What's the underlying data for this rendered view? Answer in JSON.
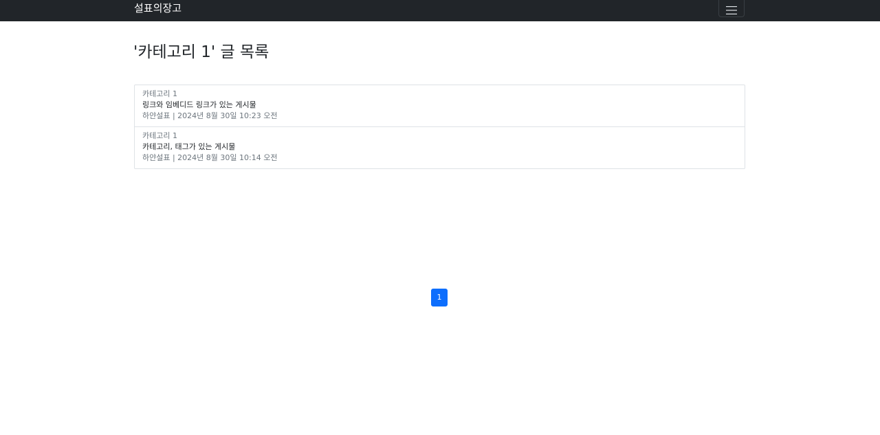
{
  "navbar": {
    "brand": "설표의장고",
    "toggler_icon": "hamburger-menu-icon"
  },
  "page": {
    "title": "'카테고리 1' 글 목록"
  },
  "posts": [
    {
      "category": "카테고리 1",
      "title": "링크와 임베디드 링크가 있는 게시물",
      "meta": "하얀설표 | 2024년 8월 30일 10:23 오전"
    },
    {
      "category": "카테고리 1",
      "title": "카테고리, 태그가 있는 게시물",
      "meta": "하얀설표 | 2024년 8월 30일 10:14 오전"
    }
  ],
  "pagination": {
    "current_page": "1"
  },
  "colors": {
    "navbar_bg": "#212529",
    "primary": "#0d6efd",
    "muted": "#6c757d",
    "border": "#dee2e6"
  }
}
